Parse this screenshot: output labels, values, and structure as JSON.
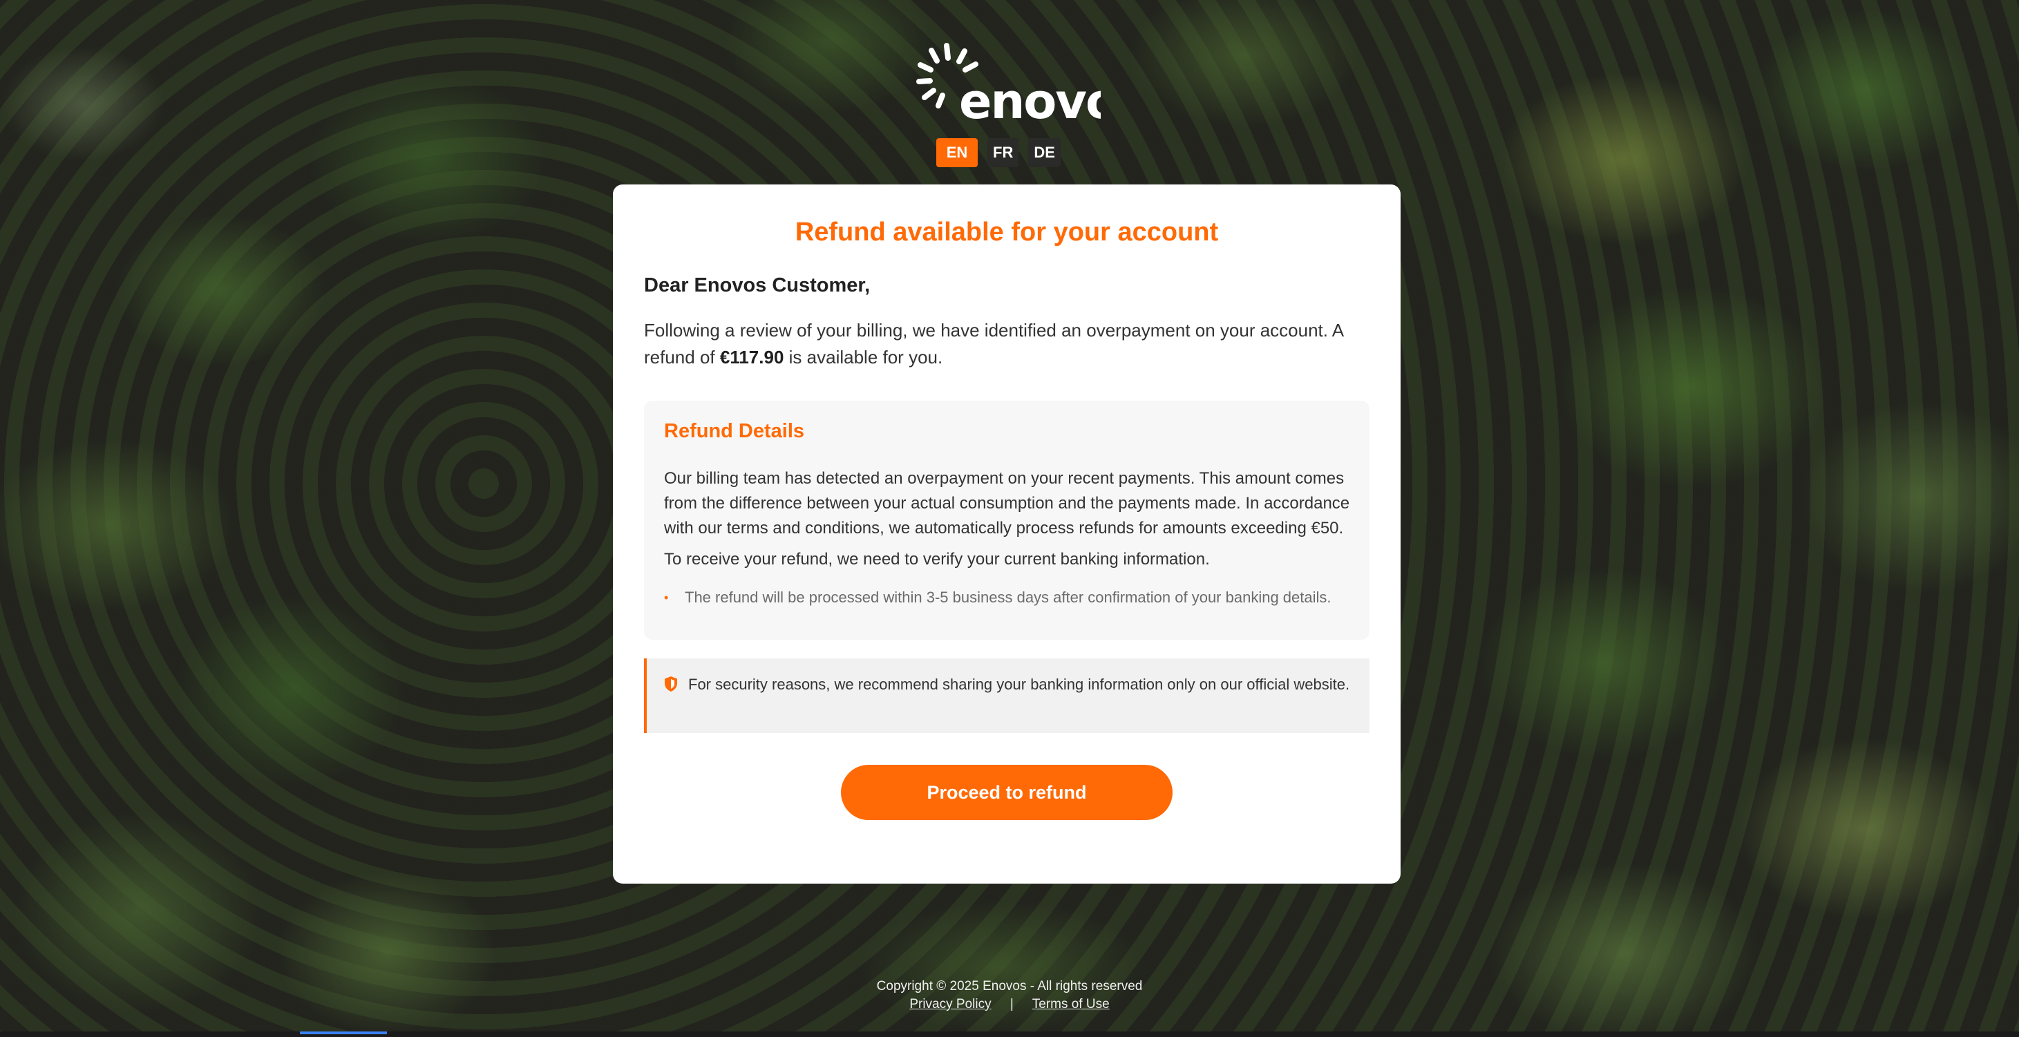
{
  "brand": {
    "name": "enovos",
    "accent_color": "#ff6a06"
  },
  "language_switcher": {
    "options": [
      "EN",
      "FR",
      "DE"
    ],
    "selected": "EN"
  },
  "card": {
    "title": "Refund available for your account",
    "greeting": "Dear Enovos Customer,",
    "intro_before": "Following a review of your billing, we have identified an overpayment on your account. A refund of ",
    "intro_amount": "€117.90",
    "intro_after": " is available for you."
  },
  "refund_details": {
    "title": "Refund Details",
    "body": "Our billing team has detected an overpayment on your recent payments. This amount comes from the difference between your actual consumption and the payments made. In accordance with our terms and conditions, we automatically process refunds for amounts exceeding €50.",
    "verify": "To receive your refund, we need to verify your current banking information.",
    "bullet": "The refund will be processed within 3-5 business days after confirmation of your banking details."
  },
  "security_notice": {
    "icon": "shield-icon",
    "text": "For security reasons, we recommend sharing your banking information only on our official website."
  },
  "cta": {
    "label": "Proceed to refund"
  },
  "footer": {
    "copyright": "Copyright © 2025 Enovos - All rights reserved",
    "privacy_label": "Privacy Policy",
    "separator": "|",
    "terms_label": "Terms of Use"
  }
}
